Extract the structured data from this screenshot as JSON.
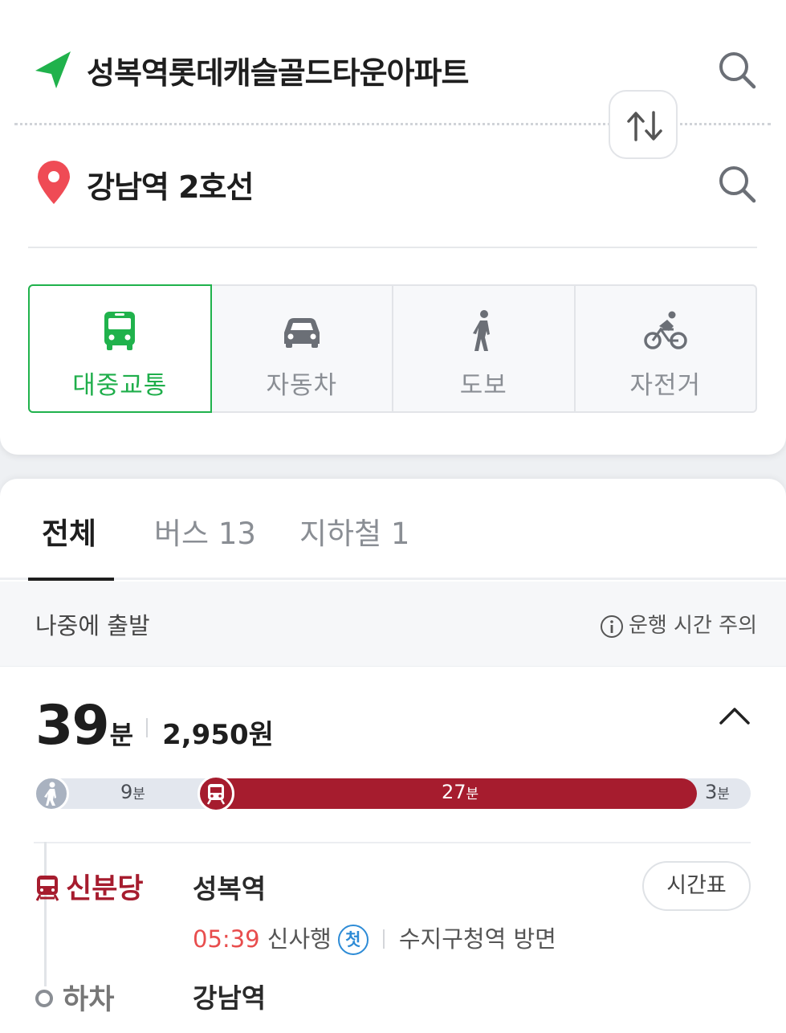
{
  "search": {
    "origin": "성복역롯데캐슬골드타운아파트",
    "destination": "강남역 2호선"
  },
  "modes": [
    {
      "label": "대중교통",
      "icon": "bus-icon",
      "active": true
    },
    {
      "label": "자동차",
      "icon": "car-icon",
      "active": false
    },
    {
      "label": "도보",
      "icon": "walk-icon",
      "active": false
    },
    {
      "label": "자전거",
      "icon": "bicycle-icon",
      "active": false
    }
  ],
  "filter_tabs": [
    {
      "label": "전체",
      "active": true
    },
    {
      "label": "버스 13",
      "active": false
    },
    {
      "label": "지하철 1",
      "active": false
    }
  ],
  "later": {
    "label": "나중에 출발",
    "notice": "운행 시간 주의"
  },
  "route": {
    "duration": "39",
    "duration_unit": "분",
    "fare": "2,950원",
    "segments": [
      {
        "type": "walk",
        "minutes": "9",
        "unit": "분"
      },
      {
        "type": "subway",
        "minutes": "27",
        "unit": "분",
        "color": "#a61c2e"
      },
      {
        "type": "walk",
        "minutes": "3",
        "unit": "분"
      }
    ],
    "line_name": "신분당",
    "start_station": "성복역",
    "timetable_label": "시간표",
    "departure_time": "05:39",
    "direction": "신사행",
    "first_badge": "첫",
    "platform": "수지구청역 방면",
    "alight_label": "하차",
    "end_station": "강남역"
  },
  "colors": {
    "accent_green": "#20b24c",
    "line_shinbundang": "#a61c2e",
    "time_red": "#e84d4d",
    "badge_blue": "#2d8bd6"
  }
}
